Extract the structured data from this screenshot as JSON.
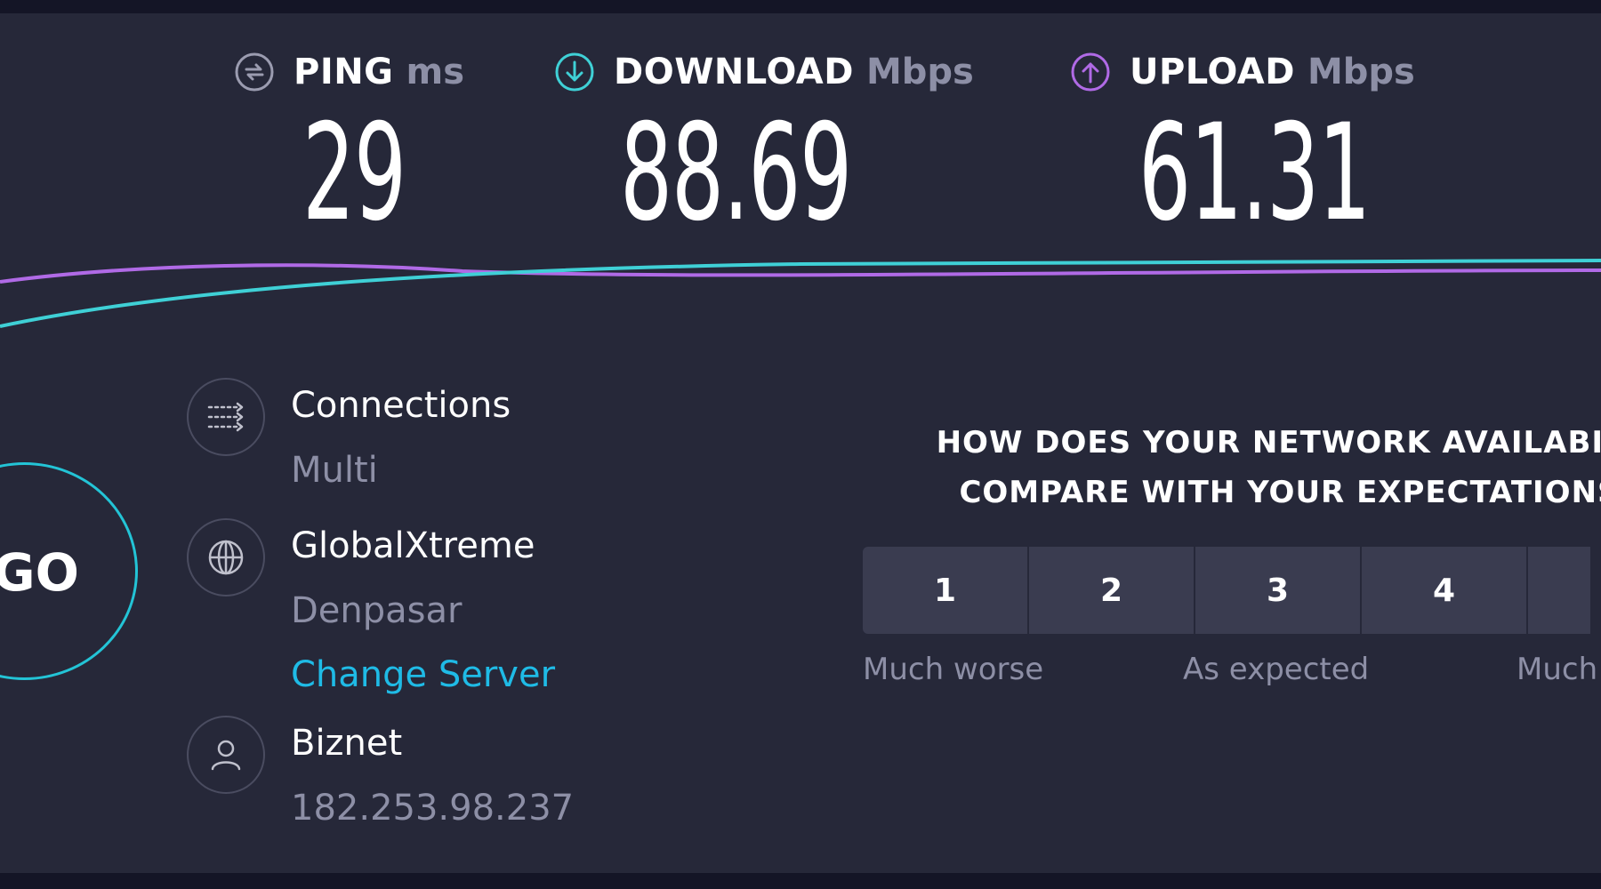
{
  "metrics": {
    "ping": {
      "label": "PING",
      "unit": "ms",
      "value": "29",
      "icon": "ping-icon",
      "color": "#9b9cb0"
    },
    "download": {
      "label": "DOWNLOAD",
      "unit": "Mbps",
      "value": "88.69",
      "icon": "download-icon",
      "color": "#3fd0d6"
    },
    "upload": {
      "label": "UPLOAD",
      "unit": "Mbps",
      "value": "61.31",
      "icon": "upload-icon",
      "color": "#b06ae6"
    }
  },
  "go_button": {
    "label": "GO",
    "color": "#23c4d6"
  },
  "connections": {
    "title": "Connections",
    "value": "Multi",
    "icon": "connections-icon"
  },
  "server": {
    "name": "GlobalXtreme",
    "location": "Denpasar",
    "change_label": "Change Server",
    "icon": "globe-icon"
  },
  "provider": {
    "name": "Biznet",
    "ip": "182.253.98.237",
    "icon": "user-icon"
  },
  "survey": {
    "question_line1": "HOW DOES YOUR NETWORK AVAILABILI",
    "question_line2": "COMPARE WITH YOUR EXPECTATIONS",
    "ratings": [
      "1",
      "2",
      "3",
      "4"
    ],
    "scale_labels": {
      "low": "Much worse",
      "mid": "As expected",
      "high": "Much"
    }
  },
  "colors": {
    "background": "#262839",
    "accent_cyan": "#23c4d6",
    "accent_purple": "#b06ae6",
    "link": "#1fbbe6",
    "muted_text": "#8d8fa6"
  }
}
